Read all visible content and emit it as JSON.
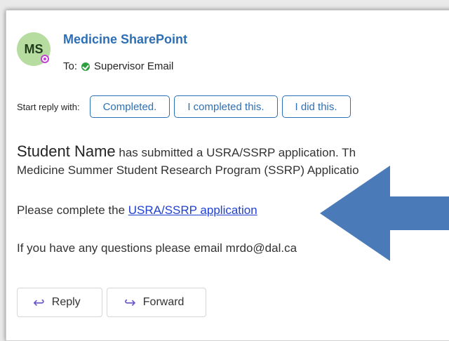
{
  "sender": {
    "initials": "MS",
    "name": "Medicine SharePoint",
    "to_label": "To:",
    "recipient": "Supervisor Email"
  },
  "suggested_replies": {
    "label": "Start reply with:",
    "options": [
      "Completed.",
      "I completed this.",
      "I did this."
    ]
  },
  "body": {
    "student_name": "Student Name",
    "line1_rest": " has submitted a USRA/SSRP application. Th",
    "line2": "Medicine Summer Student Research Program (SSRP) Applicatio",
    "line3_prefix": "Please complete the ",
    "line3_link": "USRA/SSRP application",
    "line4": "If you have any questions please email mrdo@dal.ca"
  },
  "actions": {
    "reply": "Reply",
    "forward": "Forward"
  },
  "colors": {
    "accent": "#2d6fb5",
    "arrow": "#4a7ab8",
    "presence": "#c33fd6",
    "avatar_bg": "#b7dca0"
  },
  "icons": {
    "reply": "reply-arrow-icon",
    "forward": "forward-arrow-icon",
    "status": "available-check-icon",
    "presence": "presence-icon"
  }
}
